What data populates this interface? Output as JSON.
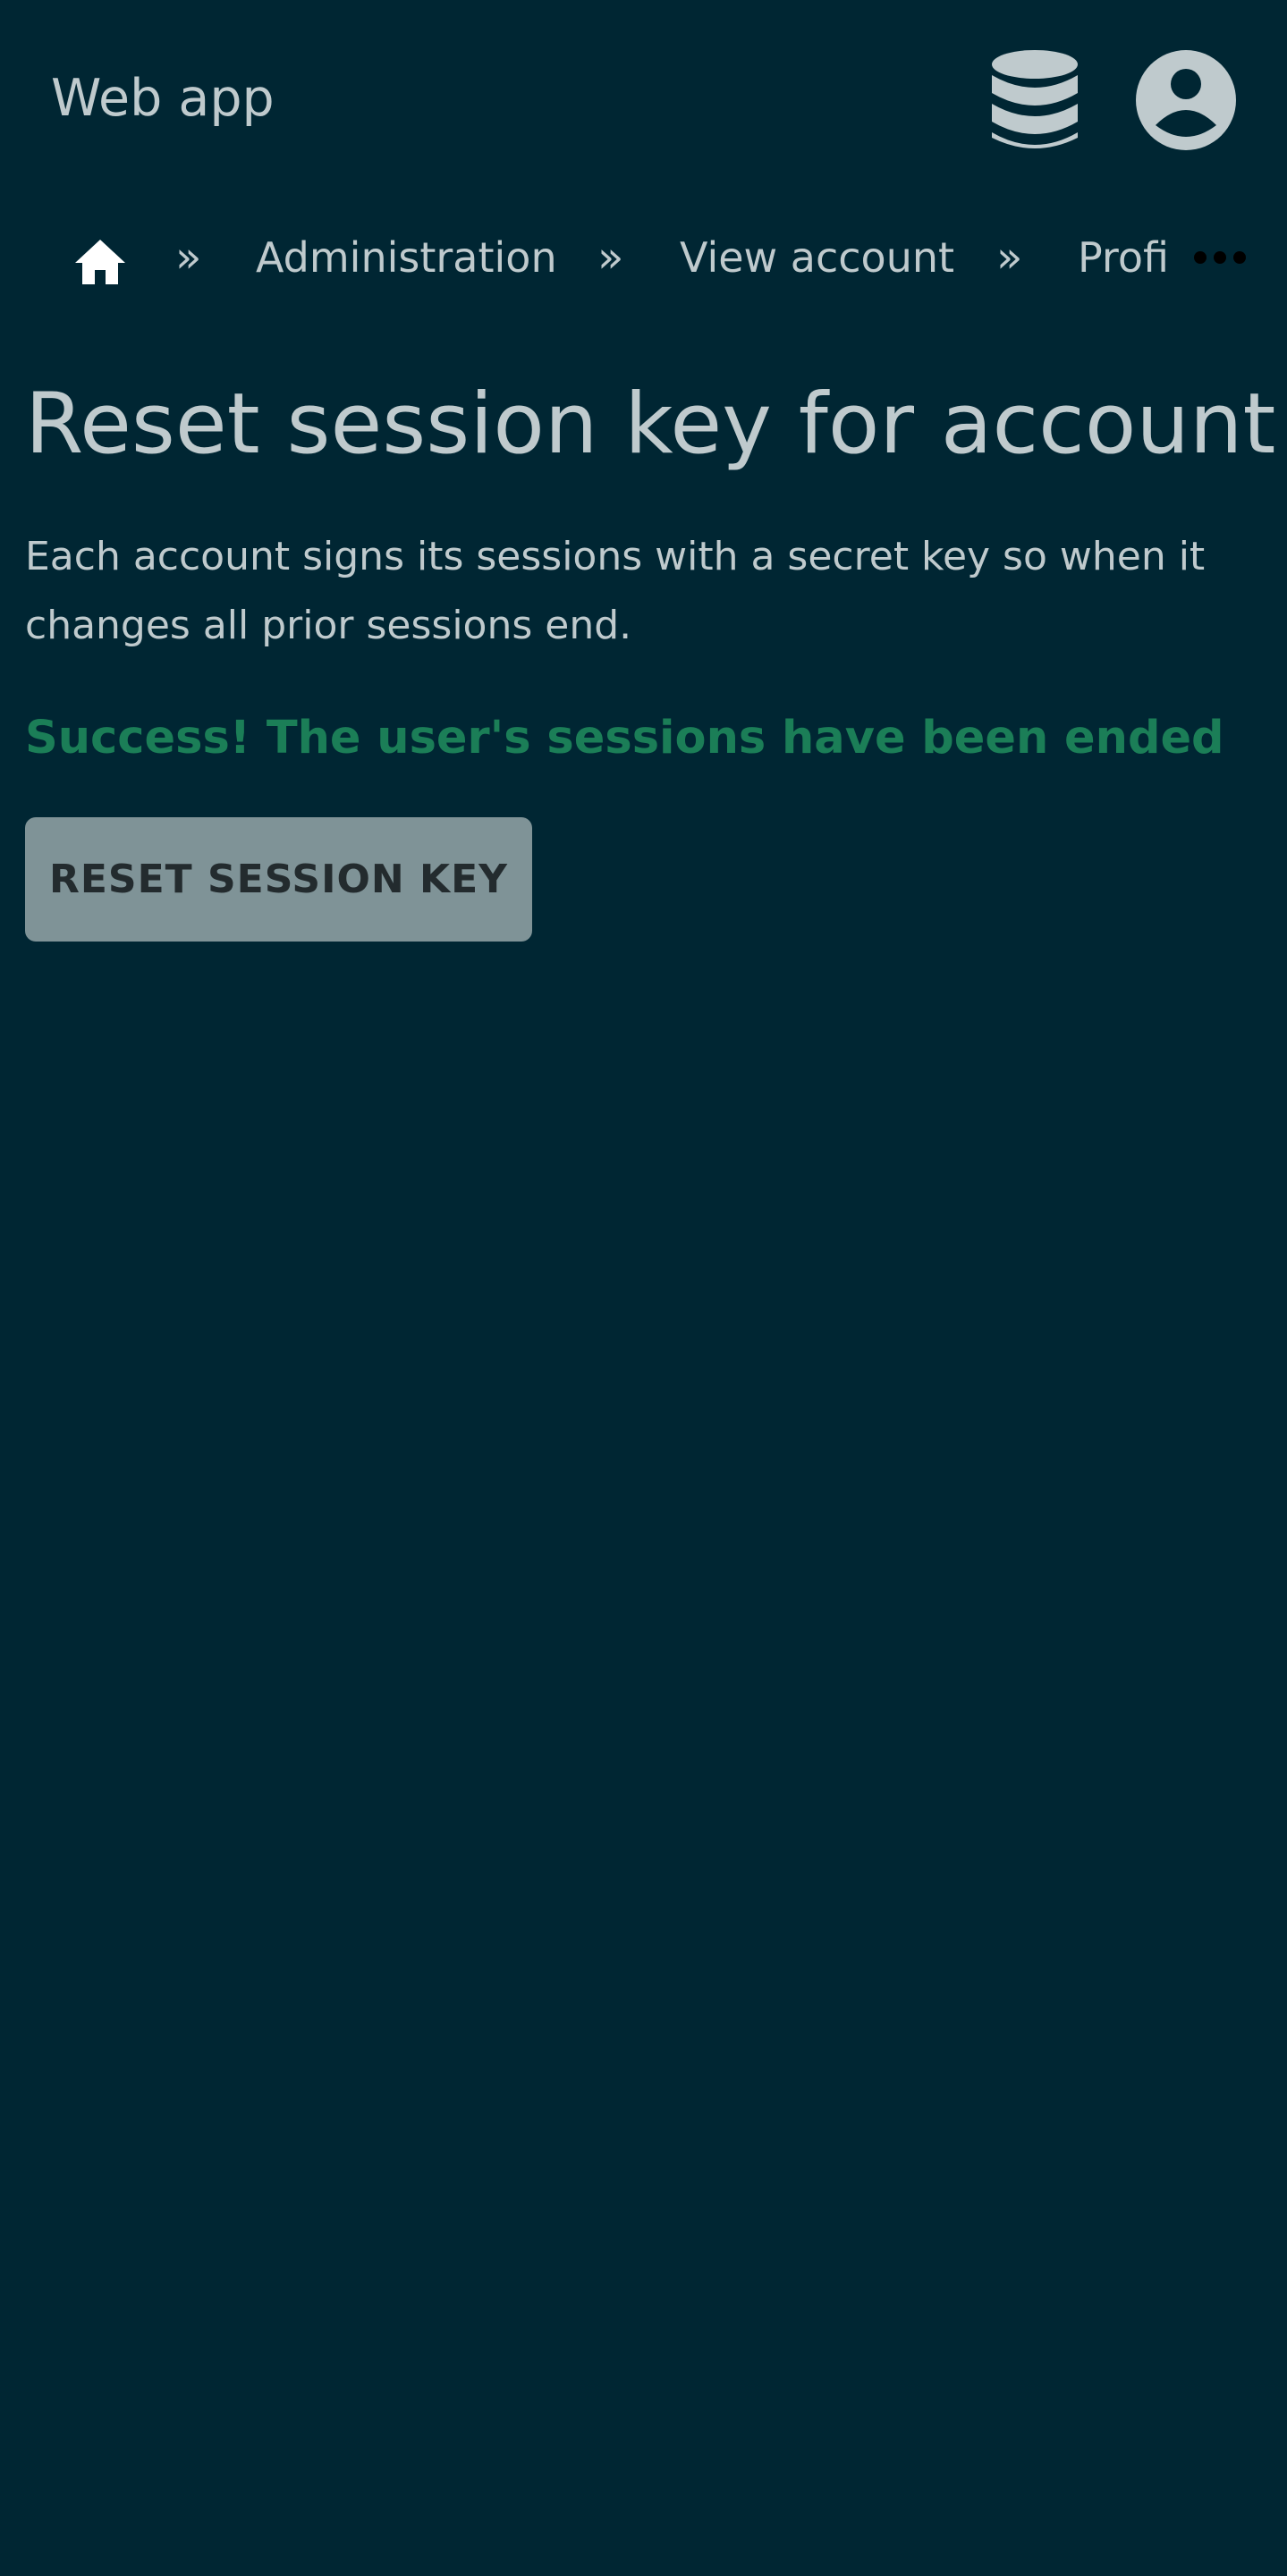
{
  "header": {
    "app_title": "Web app",
    "icons": [
      "database-icon",
      "user-account-icon"
    ]
  },
  "breadcrumb": {
    "home_icon": "home-icon",
    "separator": "»",
    "items": [
      {
        "label": "Administration"
      },
      {
        "label": "View account"
      },
      {
        "label": "Profi"
      }
    ],
    "more_icon": "more-icon"
  },
  "main": {
    "title": "Reset session key for account",
    "description": "Each account signs its sessions with a secret key so when it changes all prior sessions end.",
    "success_message": "Success! The user's sessions have been ended",
    "reset_button_label": "RESET SESSION KEY"
  },
  "colors": {
    "background": "#002633",
    "text": "#bfcacd",
    "success": "#1b7e57",
    "button_bg": "#7f9397",
    "button_text": "#232b2e"
  }
}
